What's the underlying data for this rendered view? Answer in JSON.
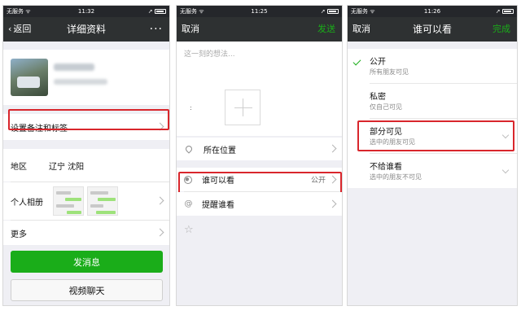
{
  "status": {
    "carrier": "无服务 ᯤ",
    "times": [
      "11:32",
      "11:25",
      "11:26"
    ]
  },
  "panel1": {
    "back_label": "返回",
    "title": "详细资料",
    "more_icon": "···",
    "remark_label": "设置备注和标签",
    "region_label": "地区",
    "region_value": "辽宁 沈阳",
    "album_label": "个人相册",
    "more_label": "更多",
    "send_button": "发消息",
    "video_button": "视频聊天"
  },
  "panel2": {
    "cancel_label": "取消",
    "send_label": "发送",
    "placeholder": "这一刻的想法...",
    "location_label": "所在位置",
    "who_label": "谁可以看",
    "who_value": "公开",
    "remind_label": "提醒谁看"
  },
  "panel3": {
    "cancel_label": "取消",
    "title": "谁可以看",
    "done_label": "完成",
    "options": [
      {
        "title": "公开",
        "subtitle": "所有朋友可见"
      },
      {
        "title": "私密",
        "subtitle": "仅自己可见"
      },
      {
        "title": "部分可见",
        "subtitle": "选中的朋友可见"
      },
      {
        "title": "不给谁看",
        "subtitle": "选中的朋友不可见"
      }
    ]
  },
  "colors": {
    "brand_green": "#1aad19",
    "navbar": "#2e3132",
    "highlight_red": "#d9262c"
  }
}
